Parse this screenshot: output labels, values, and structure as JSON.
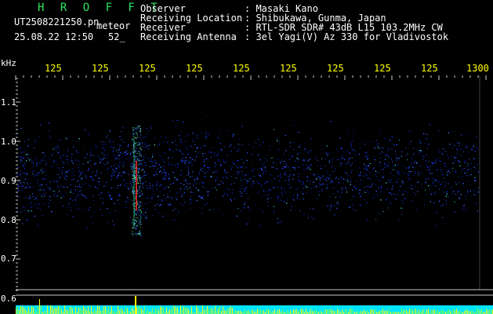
{
  "header": {
    "title": "H R O F F T",
    "filename": "UT2508221250.pn",
    "suffix": "meteor",
    "datetime": "25.08.22 12:50",
    "extra": "52_"
  },
  "info": [
    {
      "label": "Observer",
      "value": ": Masaki Kano"
    },
    {
      "label": "Receiving Location",
      "value": ": Shibukawa, Gunma, Japan"
    },
    {
      "label": "Receiver",
      "value": ": RTL-SDR SDR# 43dB L15 103.2MHz CW"
    },
    {
      "label": "Receiving Antenna",
      "value": ": 3el Yagi(V) Az 330 for Vladivostok"
    }
  ],
  "axis": {
    "y_unit": "kHz",
    "y_ticks": [
      "1.1",
      "1.0",
      "0.9",
      "0.8",
      "0.7",
      "0.6"
    ],
    "x_ticks": [
      "125",
      "125",
      "125",
      "125",
      "125",
      "125",
      "125",
      "125",
      "125",
      "1300"
    ]
  },
  "colors": {
    "signal": "#1a3cff",
    "meteor": "#ff2a2a",
    "strip": "#00e5ff",
    "spike": "#ffff00",
    "grid": "#c8c8c8"
  }
}
